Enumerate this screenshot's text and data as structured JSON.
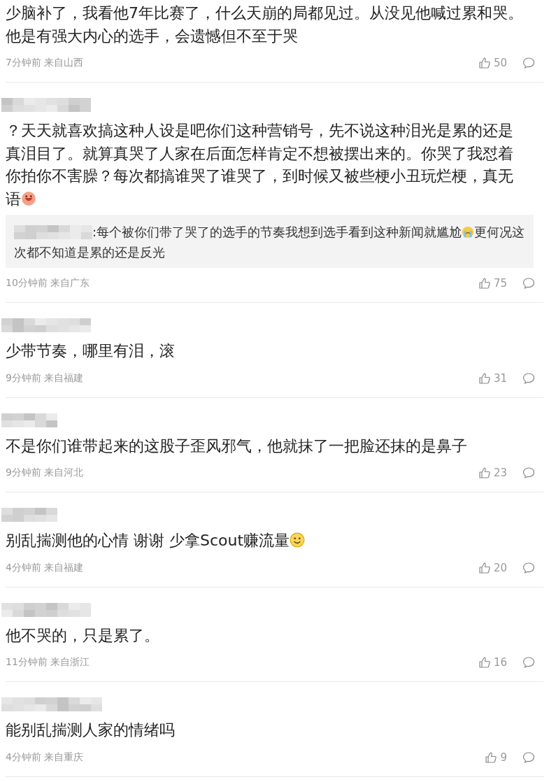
{
  "comments": [
    {
      "author_shown": false,
      "body": [
        {
          "kind": "text",
          "text": "少脑补了，我看他7年比赛了，什么天崩的局都见过。从没见他喊过累和哭。他是有强大内心的选手，会遗憾但不至于哭"
        }
      ],
      "time": "7分钟前",
      "location": "来自山西",
      "likes": "50"
    },
    {
      "author_shown": true,
      "body": [
        {
          "kind": "text",
          "text": "？天天就喜欢搞这种人设是吧你们这种营销号，先不说这种泪光是累的还是真泪目了。就算真哭了人家在后面怎样肯定不想被摆出来的。你哭了我怼着你拍你不害臊？每次都搞谁哭了谁哭了，到时候又被些梗小丑玩烂梗，真无语"
        },
        {
          "kind": "laugh"
        }
      ],
      "reply": [
        {
          "kind": "text",
          "text": ":每个被你们带了哭了的选手的节奏我想到选手看到这种新闻就尴尬"
        },
        {
          "kind": "tears"
        },
        {
          "kind": "text",
          "text": "更何况这次都不知道是累的还是反光"
        }
      ],
      "time": "10分钟前",
      "location": "来自广东",
      "likes": "75"
    },
    {
      "author_shown": true,
      "body": [
        {
          "kind": "text",
          "text": "少带节奏，哪里有泪，滚"
        }
      ],
      "time": "9分钟前",
      "location": "来自福建",
      "likes": "31"
    },
    {
      "author_shown": true,
      "body": [
        {
          "kind": "text",
          "text": "不是你们谁带起来的这股子歪风邪气，他就抹了一把脸还抹的是鼻子"
        }
      ],
      "time": "9分钟前",
      "location": "来自河北",
      "likes": "23"
    },
    {
      "author_shown": true,
      "body": [
        {
          "kind": "text",
          "text": "别乱揣测他的心情 谢谢 少拿Scout赚流量"
        },
        {
          "kind": "smile"
        }
      ],
      "time": "4分钟前",
      "location": "来自福建",
      "likes": "20"
    },
    {
      "author_shown": true,
      "body": [
        {
          "kind": "text",
          "text": "他不哭的，只是累了。"
        }
      ],
      "time": "11分钟前",
      "location": "来自浙江",
      "likes": "16"
    },
    {
      "author_shown": true,
      "body": [
        {
          "kind": "text",
          "text": "能别乱揣测人家的情绪吗"
        }
      ],
      "time": "4分钟前",
      "location": "来自重庆",
      "likes": "9"
    }
  ]
}
